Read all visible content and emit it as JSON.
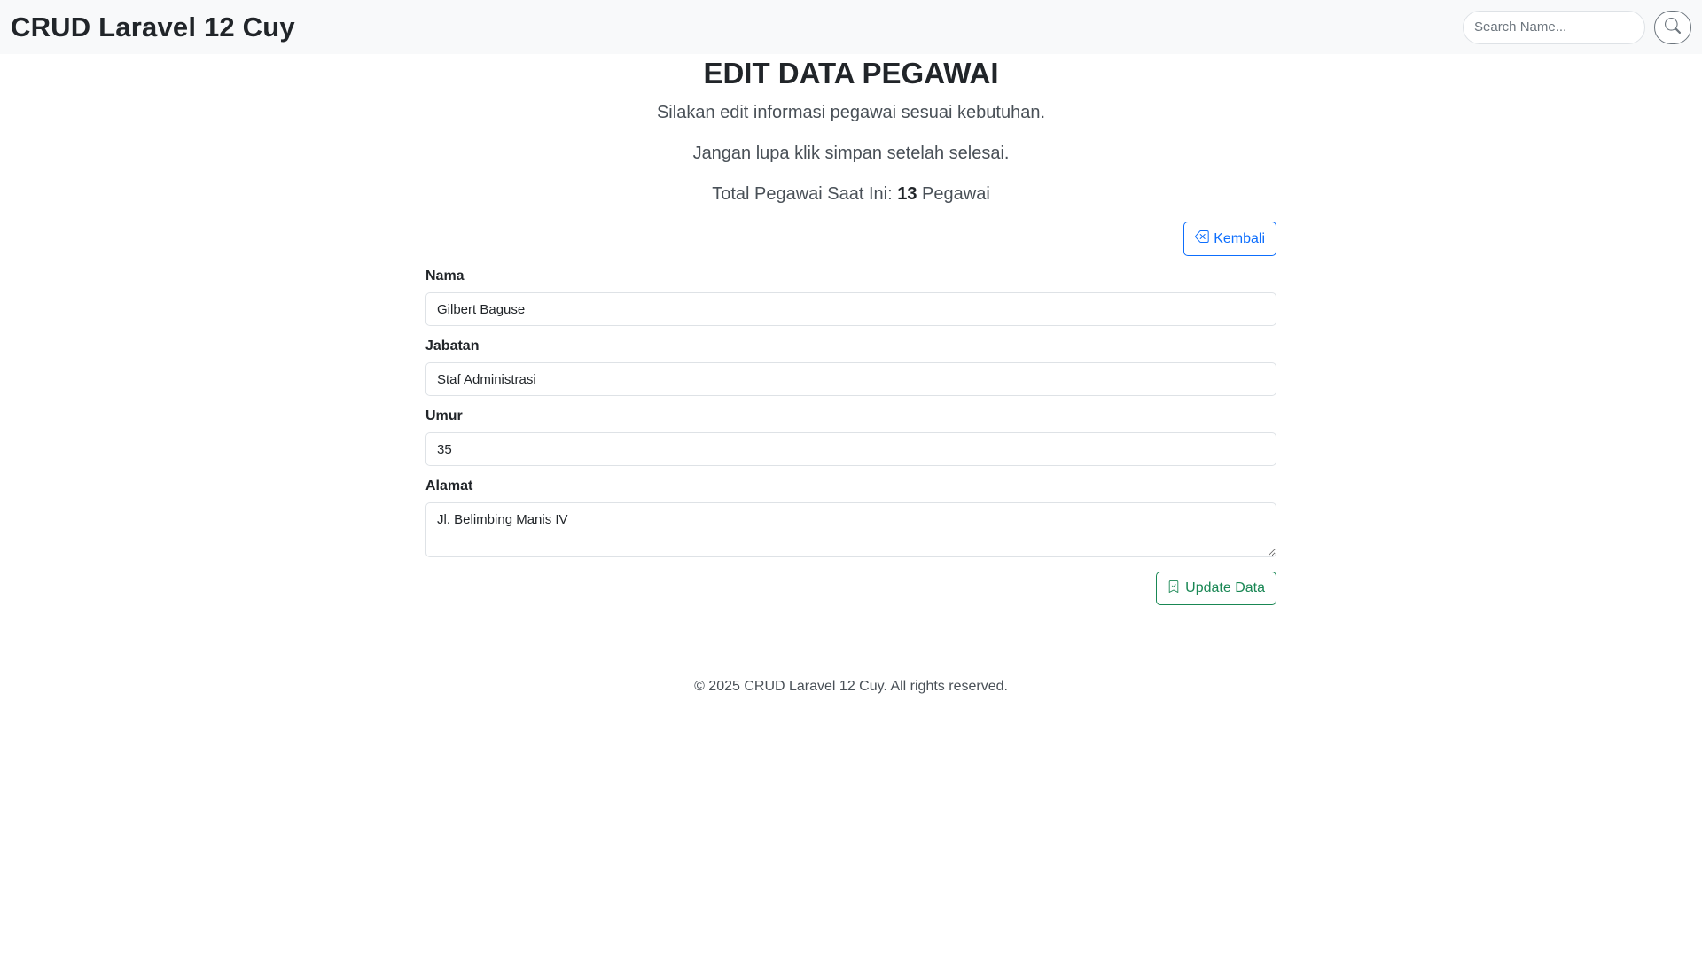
{
  "navbar": {
    "brand": "CRUD Laravel 12 Cuy",
    "search_placeholder": "Search Name...",
    "search_icon": "search-icon"
  },
  "header": {
    "title": "EDIT DATA PEGAWAI",
    "line1": "Silakan edit informasi pegawai sesuai kebutuhan.",
    "line2": "Jangan lupa klik simpan setelah selesai.",
    "total_prefix": "Total Pegawai Saat Ini: ",
    "total_count": "13",
    "total_suffix": " Pegawai"
  },
  "back_button": {
    "label": "Kembali",
    "icon": "backspace-icon"
  },
  "form": {
    "nama": {
      "label": "Nama",
      "value": "Gilbert Baguse"
    },
    "jabatan": {
      "label": "Jabatan",
      "value": "Staf Administrasi"
    },
    "umur": {
      "label": "Umur",
      "value": "35"
    },
    "alamat": {
      "label": "Alamat",
      "value": "Jl. Belimbing Manis IV"
    }
  },
  "submit_button": {
    "label": "Update Data",
    "icon": "bookmark-icon"
  },
  "footer": {
    "text": "© 2025 CRUD Laravel 12 Cuy. All rights reserved."
  },
  "colors": {
    "primary": "#0d6efd",
    "success": "#198754",
    "navbar_bg": "#f8f9fa"
  }
}
